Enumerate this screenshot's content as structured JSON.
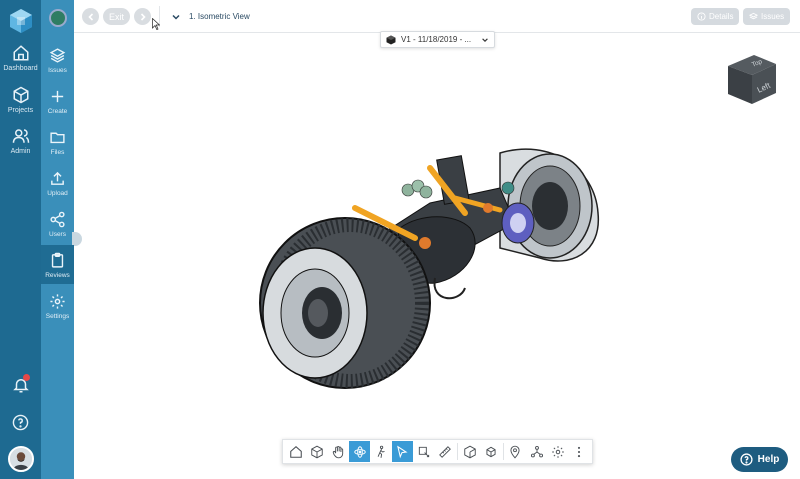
{
  "rail_primary": {
    "items": [
      {
        "label": "Dashboard",
        "icon": "home-icon"
      },
      {
        "label": "Projects",
        "icon": "cube-icon"
      },
      {
        "label": "Admin",
        "icon": "users-icon"
      }
    ]
  },
  "rail_secondary": {
    "items": [
      {
        "label": "Issues",
        "icon": "layers-icon"
      },
      {
        "label": "Create",
        "icon": "plus-icon"
      },
      {
        "label": "Files",
        "icon": "folder-icon"
      },
      {
        "label": "Upload",
        "icon": "upload-icon"
      },
      {
        "label": "Users",
        "icon": "share-icon"
      },
      {
        "label": "Reviews",
        "icon": "clipboard-icon"
      },
      {
        "label": "Settings",
        "icon": "gear-icon"
      }
    ],
    "active": "Reviews"
  },
  "topbar": {
    "exit_label": "Exit",
    "view_title": "1. Isometric View",
    "details_label": "Details",
    "issues_label": "Issues"
  },
  "version_selector": {
    "value": "V1 - 11/18/2019 - ..."
  },
  "view_cube": {
    "face_top": "Top",
    "face_right": "Left"
  },
  "toolbar": {
    "tools": [
      "home-icon",
      "cube-outline-icon",
      "pan-hand-icon",
      "orbit-icon",
      "walk-icon",
      "select-arrow-icon",
      "section-box-icon",
      "measure-icon",
      "box-icon",
      "explode-icon",
      "pin-icon",
      "structure-icon",
      "gear-icon",
      "more-icon"
    ],
    "active": [
      "orbit-icon",
      "select-arrow-icon"
    ]
  },
  "help": {
    "label": "Help"
  },
  "colors": {
    "rail_primary": "#1e6a91",
    "rail_secondary": "#3a8fba",
    "accent": "#3a9bd6",
    "help_button": "#1e5c80"
  }
}
